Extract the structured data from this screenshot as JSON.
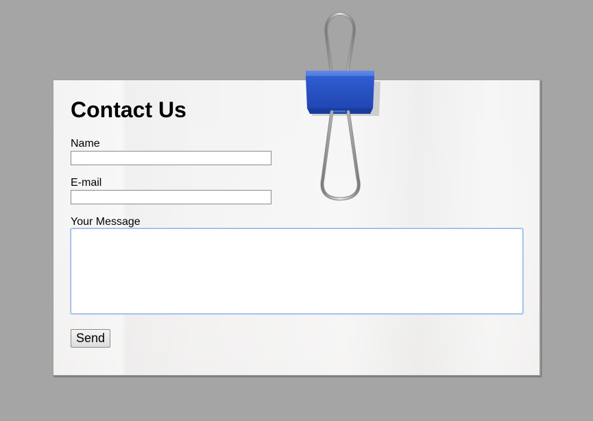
{
  "form": {
    "title": "Contact Us",
    "name_label": "Name",
    "name_value": "",
    "email_label": "E-mail",
    "email_value": "",
    "message_label": "Your Message",
    "message_value": "",
    "send_label": "Send"
  },
  "decoration": {
    "clip_icon": "binder-clip-icon",
    "clip_color": "#2a55c8"
  }
}
